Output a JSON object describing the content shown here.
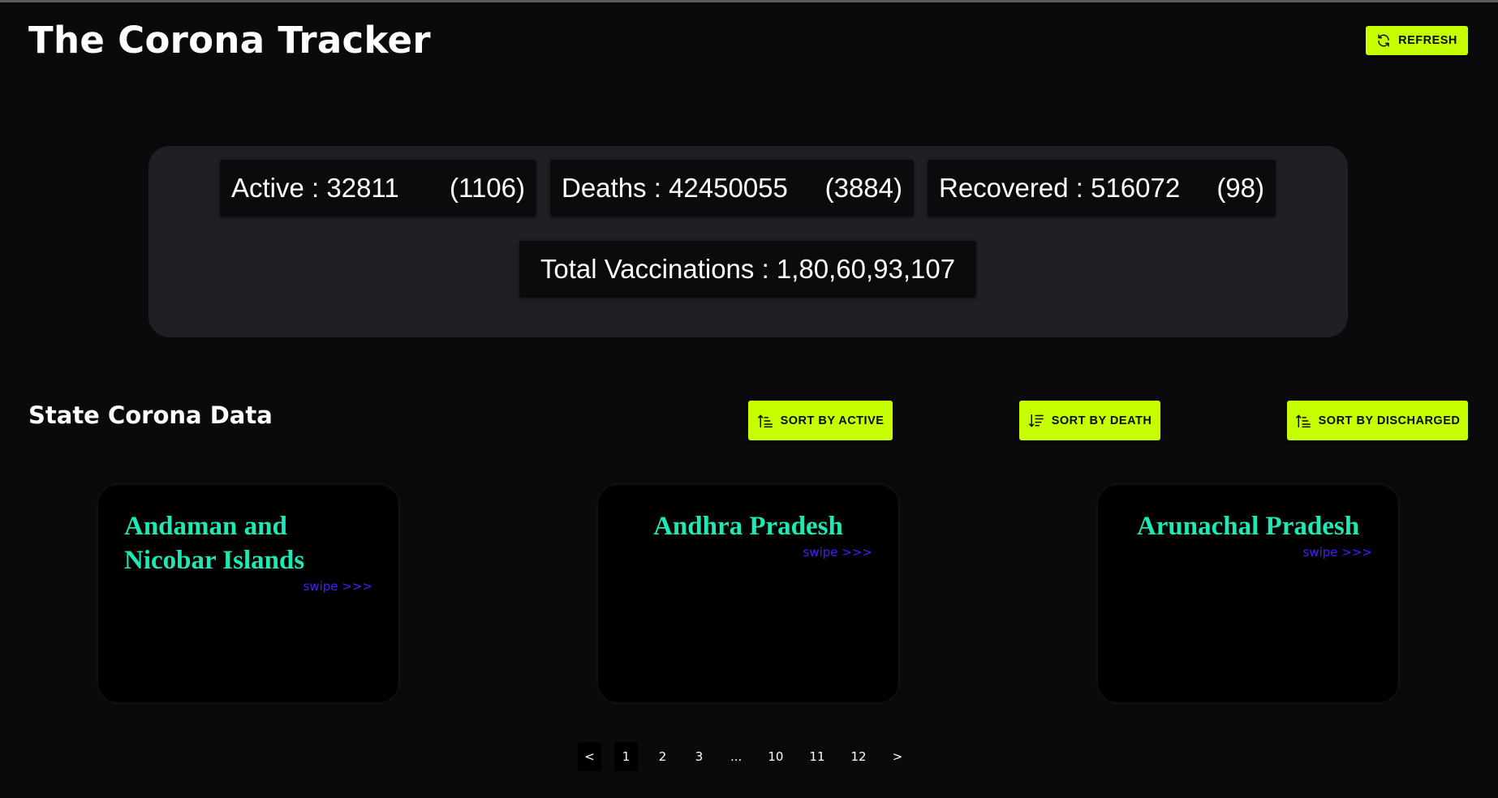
{
  "header": {
    "title": "The Corona Tracker",
    "refresh_label": "REFRESH"
  },
  "summary": {
    "active_label": "Active : 32811",
    "active_delta": "(1106)",
    "deaths_label": "Deaths : 42450055",
    "deaths_delta": "(3884)",
    "recovered_label": "Recovered : 516072",
    "recovered_delta": "(98)",
    "vaccinations": "Total Vaccinations : 1,80,60,93,107"
  },
  "states_section": {
    "title": "State Corona Data",
    "sort_active_label": "SORT BY ACTIVE",
    "sort_death_label": "SORT BY DEATH",
    "sort_discharged_label": "SORT BY DISCHARGED"
  },
  "cards": [
    {
      "name": "Andaman and Nicobar Islands",
      "swipe": "swipe >>>"
    },
    {
      "name": "Andhra Pradesh",
      "swipe": "swipe >>>"
    },
    {
      "name": "Arunachal Pradesh",
      "swipe": "swipe >>>"
    }
  ],
  "pagination": {
    "prev": "<",
    "pages": [
      "1",
      "2",
      "3",
      "...",
      "10",
      "11",
      "12"
    ],
    "next": ">",
    "current": "1"
  },
  "colors": {
    "accent": "#c6ff00",
    "state_name": "#1de9b6",
    "swipe": "#4a1bff",
    "background": "#0a0a0d",
    "panel": "#1f1f24"
  },
  "icons": {
    "refresh": "refresh-icon",
    "sort_ascending": "sort-ascending-icon",
    "sort_descending": "sort-descending-icon"
  }
}
